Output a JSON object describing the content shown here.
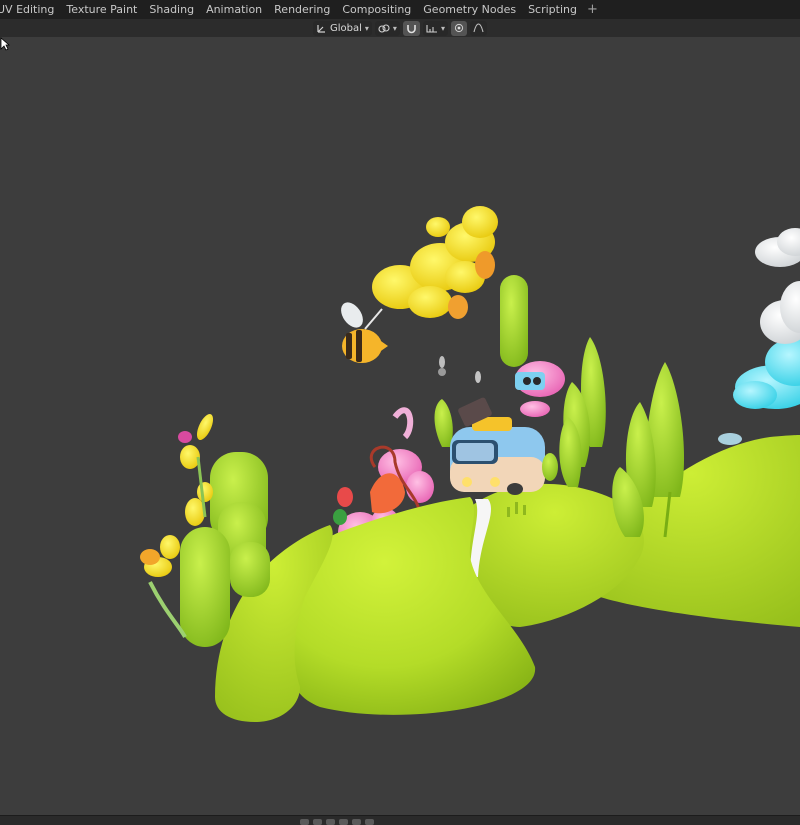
{
  "workspace_tabs": [
    {
      "id": "uv-editing",
      "label": "UV Editing"
    },
    {
      "id": "texture-paint",
      "label": "Texture Paint"
    },
    {
      "id": "shading",
      "label": "Shading"
    },
    {
      "id": "animation",
      "label": "Animation"
    },
    {
      "id": "rendering",
      "label": "Rendering"
    },
    {
      "id": "compositing",
      "label": "Compositing"
    },
    {
      "id": "geometry-nodes",
      "label": "Geometry Nodes"
    },
    {
      "id": "scripting",
      "label": "Scripting"
    }
  ],
  "add_workspace_icon": "plus-icon",
  "header": {
    "transform_orientation": "Global",
    "orientation_icon": "transform-orientation-icon",
    "pivot_icon": "pivot-point-icon",
    "snap_icon": "snap-magnet-icon",
    "snap_target_icon": "snap-increment-icon",
    "proportional_icon": "proportional-editing-icon",
    "falloff_icon": "falloff-curve-icon"
  },
  "viewport": {
    "background": "#3d3d3d",
    "scene": "stylized-cartoon-landscape"
  },
  "colors": {
    "hill": "#b8e02a",
    "hill_shadow": "#8fb81e",
    "cloud_yellow": "#f5e623",
    "cloud_cyan": "#5fe4f2",
    "bus_blue": "#8ec8ee",
    "pink": "#f58ac8",
    "bee_stripe": "#3a2a1a"
  }
}
